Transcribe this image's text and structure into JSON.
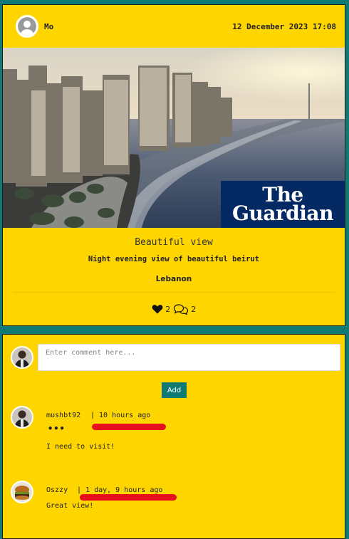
{
  "post": {
    "username": "Mo",
    "timestamp": "12 December 2023 17:08",
    "image_watermark": "The Guardian",
    "title": "Beautiful view",
    "description": "Night evening view of beautiful beirut",
    "location": "Lebanon",
    "likes": "2",
    "comments_count": "2"
  },
  "composer": {
    "placeholder": "Enter comment here...",
    "add_label": "Add"
  },
  "comments": [
    {
      "author": "mushbt92",
      "time": "| 10 hours ago",
      "text": "I need to visit!",
      "has_menu": true
    },
    {
      "author": "Oszzy",
      "time": "| 1 day, 9 hours ago",
      "text": "Great view!"
    }
  ],
  "colors": {
    "background": "#0f7a73",
    "card": "#ffd500",
    "button": "#0f7a73",
    "annotation": "#e5101c"
  }
}
